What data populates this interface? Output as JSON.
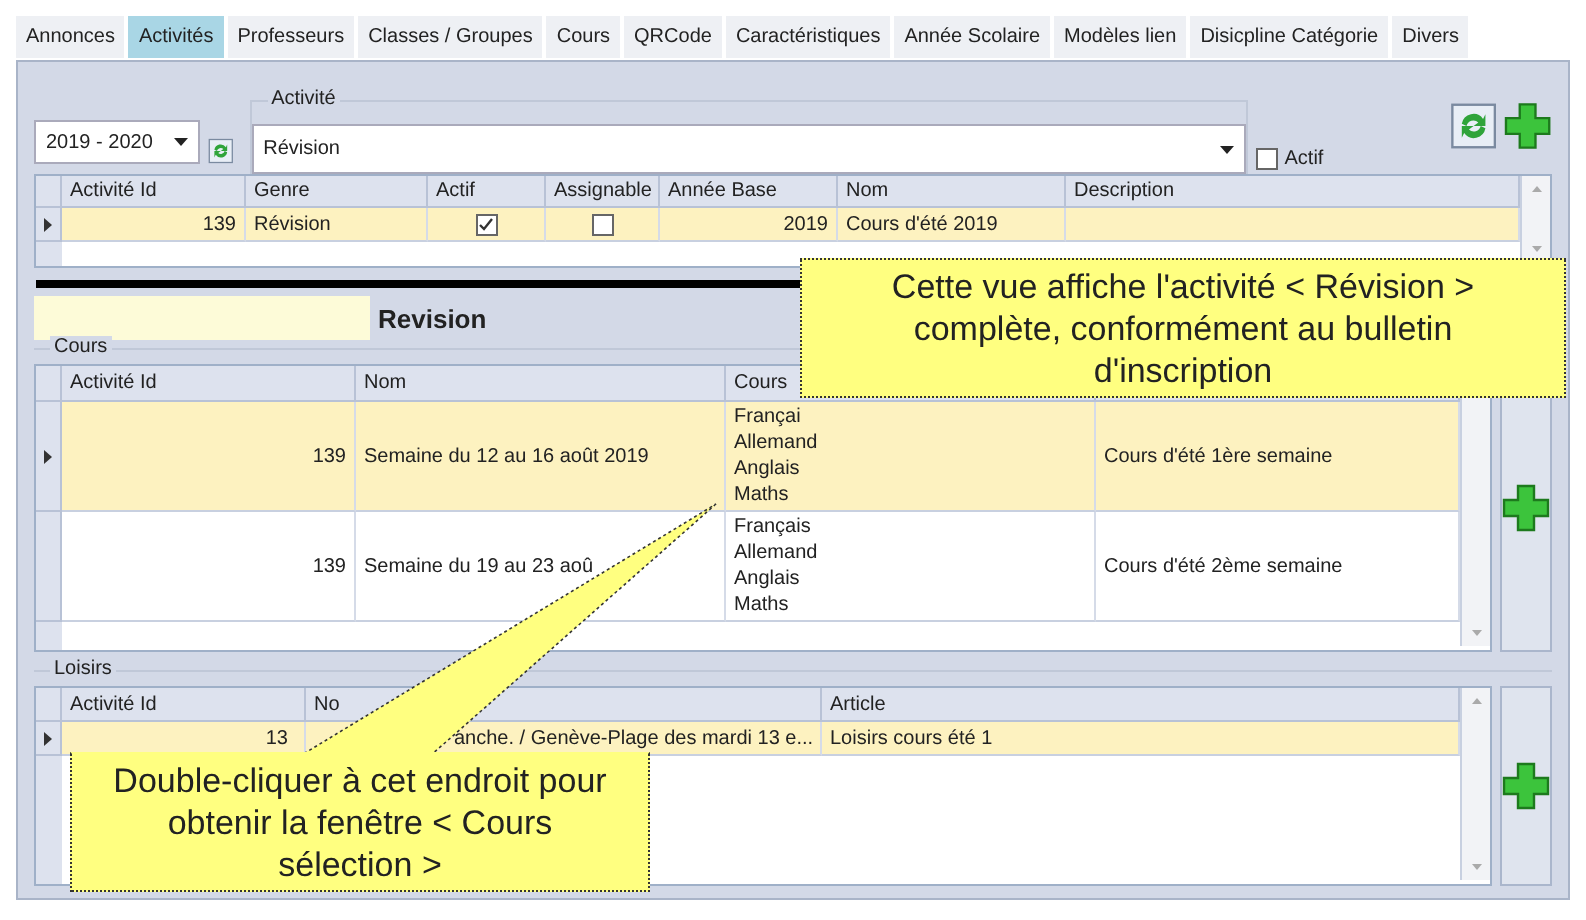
{
  "tabs": [
    {
      "label": "Annonces",
      "selected": false
    },
    {
      "label": "Activités",
      "selected": true
    },
    {
      "label": "Professeurs",
      "selected": false
    },
    {
      "label": "Classes / Groupes",
      "selected": false
    },
    {
      "label": "Cours",
      "selected": false
    },
    {
      "label": "QRCode",
      "selected": false
    },
    {
      "label": "Caractéristiques",
      "selected": false
    },
    {
      "label": "Année Scolaire",
      "selected": false
    },
    {
      "label": "Modèles lien",
      "selected": false
    },
    {
      "label": "Disicpline Catégorie",
      "selected": false
    },
    {
      "label": "Divers",
      "selected": false
    }
  ],
  "year_select": {
    "value": "2019 - 2020"
  },
  "activity_field": {
    "label": "Activité",
    "value": "Révision"
  },
  "actif_filter": {
    "label": "Actif",
    "checked": false
  },
  "activities_table": {
    "columns": [
      "Activité Id",
      "Genre",
      "Actif",
      "Assignable",
      "Année Base",
      "Nom",
      "Description"
    ],
    "rows": [
      {
        "id": "139",
        "genre": "Révision",
        "actif": true,
        "assignable": false,
        "annee_base": "2019",
        "nom": "Cours d'été 2019",
        "selected": true
      }
    ]
  },
  "banner": {
    "title": "Revision"
  },
  "cours": {
    "title": "Cours",
    "columns": [
      "Activité Id",
      "Nom",
      "Cours"
    ],
    "rows": [
      {
        "id": "139",
        "nom": "Semaine du 12 au 16 août 2019",
        "cours": [
          "Françai",
          "Allemand",
          "Anglais",
          "Maths"
        ],
        "column_4": "Cours d'été 1ère semaine",
        "selected": true
      },
      {
        "id": "139",
        "nom": "Semaine du 19 au 23 aoû",
        "cours": [
          "Français",
          "Allemand",
          "Anglais",
          "Maths"
        ],
        "column_4": "Cours d'été 2ème semaine",
        "selected": false
      }
    ]
  },
  "loisirs": {
    "title": "Loisirs",
    "columns": [
      "Activité Id",
      "No",
      "Article"
    ],
    "rows": [
      {
        "id": "13",
        "nom": "anche. / Genève-Plage des mardi 13 e...",
        "article": "Loisirs cours été 1",
        "selected": true
      }
    ]
  },
  "callouts": [
    {
      "kind": "box",
      "text": "Cette vue affiche l'activité < Révision > complète, conformément au bulletin d'inscription"
    },
    {
      "kind": "pointer",
      "text": "Double-cliquer à cet endroit pour obtenir la fenêtre < Cours sélection >"
    }
  ]
}
